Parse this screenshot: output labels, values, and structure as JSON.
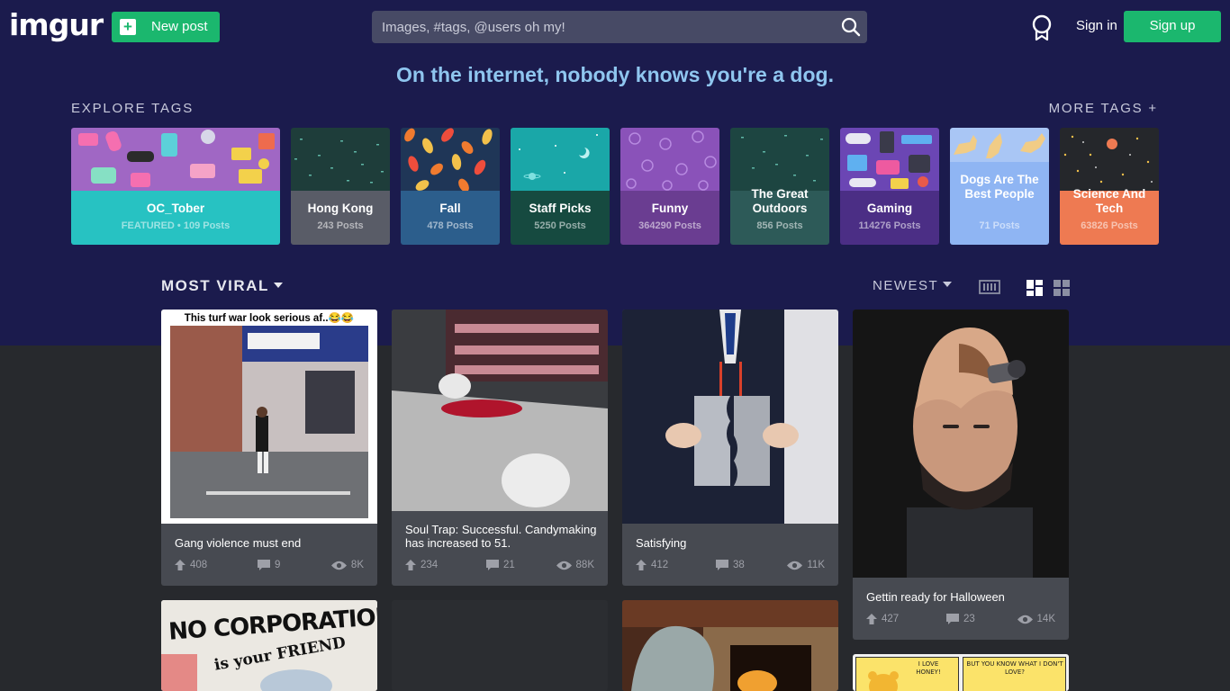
{
  "header": {
    "logo": "imgur",
    "new_post_label": "New post",
    "search_placeholder": "Images, #tags, @users oh my!",
    "sign_in_label": "Sign in",
    "sign_up_label": "Sign up"
  },
  "tagline": "On the internet, nobody knows you're a dog.",
  "explore": {
    "title": "EXPLORE TAGS",
    "more_label": "MORE TAGS +",
    "tags": [
      {
        "name": "OC_Tober",
        "count": "FEATURED • 109 Posts",
        "color": "#27c2c2"
      },
      {
        "name": "Hong Kong",
        "count": "243 Posts",
        "color": "#595c67"
      },
      {
        "name": "Fall",
        "count": "478 Posts",
        "color": "#2c5e8c"
      },
      {
        "name": "Staff Picks",
        "count": "5250 Posts",
        "color": "#164a40"
      },
      {
        "name": "Funny",
        "count": "364290 Posts",
        "color": "#6a3d91"
      },
      {
        "name": "The Great Outdoors",
        "count": "856 Posts",
        "color": "#2d5a58"
      },
      {
        "name": "Gaming",
        "count": "114276 Posts",
        "color": "#4b2e85"
      },
      {
        "name": "Dogs Are The Best People",
        "count": "71 Posts",
        "color": "#8fb5f3"
      },
      {
        "name": "Science And Tech",
        "count": "63826 Posts",
        "color": "#ee7a52"
      }
    ]
  },
  "feed": {
    "sort_label": "MOST VIRAL",
    "order_label": "NEWEST",
    "posts": [
      {
        "title": "Gang violence must end",
        "upvotes": "408",
        "comments": "9",
        "views": "8K",
        "caption": "This turf war look serious af..😂😂"
      },
      {
        "title": "Soul Trap: Successful. Candymaking has increased to 51.",
        "upvotes": "234",
        "comments": "21",
        "views": "88K"
      },
      {
        "title": "Satisfying",
        "upvotes": "412",
        "comments": "38",
        "views": "11K"
      },
      {
        "title": "Gettin ready for Halloween",
        "upvotes": "427",
        "comments": "23",
        "views": "14K"
      },
      {
        "image_text_1": "NO CORPORATION",
        "image_text_2": "is your FRIEND"
      },
      {},
      {},
      {
        "panel_1": "I LOVE HONEY!",
        "panel_2": "BUT YOU KNOW WHAT I DON'T LOVE?"
      }
    ]
  }
}
